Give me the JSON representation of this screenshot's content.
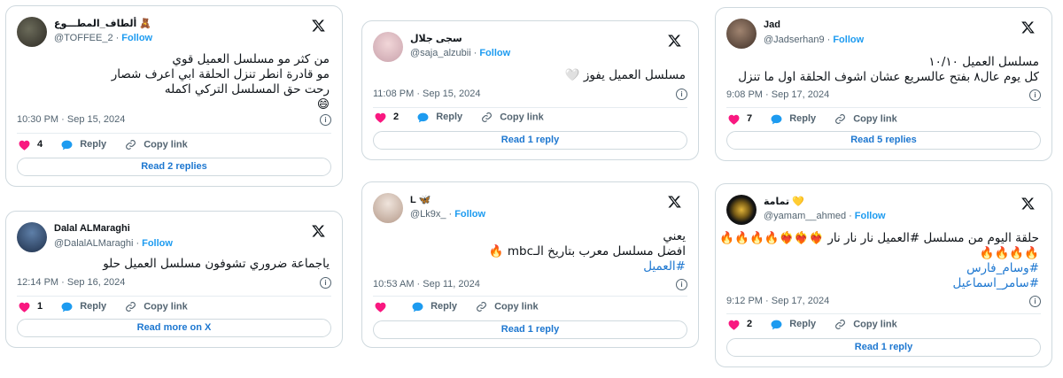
{
  "common": {
    "follow": "Follow",
    "reply": "Reply",
    "copy_link": "Copy link",
    "like_color": "#f91880",
    "reply_color": "#1d9bf0"
  },
  "tweets": [
    {
      "name": "ألطاف_المطـــوع 🧸",
      "handle": "@TOFFEE_2",
      "lines": [
        "من كثر مو مسلسل العميل قوي",
        "مو قادرة انطر تنزل الحلقة ابي اعرف شصار",
        "رحت حق المسلسل التركي اكمله",
        "😄"
      ],
      "timestamp": "10:30 PM · Sep 15, 2024",
      "likes": "4",
      "cta": "Read 2 replies"
    },
    {
      "name": "Dalal ALMaraghi",
      "handle": "@DalalALMaraghi",
      "lines": [
        "ياجماعة ضروري تشوفون مسلسل العميل حلو"
      ],
      "timestamp": "12:14 PM · Sep 16, 2024",
      "likes": "1",
      "cta": "Read more on X"
    },
    {
      "name": "سجى جلال",
      "handle": "@saja_alzubii",
      "lines": [
        "مسلسل العميل يفوز 🤍"
      ],
      "timestamp": "11:08 PM · Sep 15, 2024",
      "likes": "2",
      "cta": "Read 1 reply"
    },
    {
      "name": "L 🦋",
      "handle": "@Lk9x_",
      "lines": [
        "يعني",
        "افضل مسلسل معرب بتاريخ الـmbc 🔥",
        "#العميل"
      ],
      "timestamp": "10:53 AM · Sep 11, 2024",
      "likes": "",
      "cta": "Read 1 reply"
    },
    {
      "name": "Jad",
      "handle": "@Jadserhan9",
      "lines": [
        "مسلسل العميل ١٠/١٠",
        "كل يوم عال٨ بفتح عالسريع عشان اشوف الحلقة اول ما تنزل"
      ],
      "timestamp": "9:08 PM · Sep 17, 2024",
      "likes": "7",
      "cta": "Read 5 replies"
    },
    {
      "name": "تمامة 💛",
      "handle": "@yamam__ahmed",
      "lines": [
        "حلقة اليوم من مسلسل #العميل نار نار نار ❤️‍🔥❤️‍🔥❤️‍🔥🔥🔥🔥🔥",
        "🔥🔥🔥🔥",
        "#وسام_فارس",
        "#سامر_اسماعيل"
      ],
      "timestamp": "9:12 PM · Sep 17, 2024",
      "likes": "2",
      "cta": "Read 1 reply"
    }
  ]
}
